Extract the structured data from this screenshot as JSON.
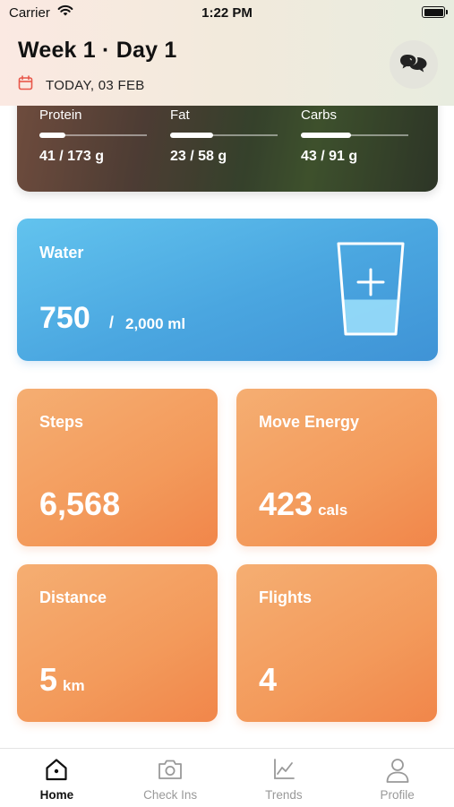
{
  "status_bar": {
    "carrier": "Carrier",
    "time": "1:22 PM"
  },
  "header": {
    "title": "Week 1 · Day 1",
    "date": "TODAY, 03 FEB",
    "accent": "#e8574a"
  },
  "macros": [
    {
      "label": "Protein",
      "value": "41 / 173 g",
      "progress": 0.24
    },
    {
      "label": "Fat",
      "value": "23 / 58 g",
      "progress": 0.4
    },
    {
      "label": "Carbs",
      "value": "43 / 91 g",
      "progress": 0.47
    }
  ],
  "water": {
    "title": "Water",
    "amount": "750",
    "separator": "/",
    "goal": "2,000 ml",
    "fill_fraction": 0.375,
    "icon": "glass-plus-icon"
  },
  "stats": [
    {
      "title": "Steps",
      "value": "6,568",
      "unit": ""
    },
    {
      "title": "Move Energy",
      "value": "423",
      "unit": "cals"
    },
    {
      "title": "Distance",
      "value": "5",
      "unit": "km"
    },
    {
      "title": "Flights",
      "value": "4",
      "unit": ""
    }
  ],
  "tabs": [
    {
      "label": "Home",
      "icon": "home-icon",
      "active": true
    },
    {
      "label": "Check Ins",
      "icon": "camera-icon",
      "active": false
    },
    {
      "label": "Trends",
      "icon": "trends-icon",
      "active": false
    },
    {
      "label": "Profile",
      "icon": "profile-icon",
      "active": false
    }
  ],
  "colors": {
    "water_card": "#4aa6e0",
    "stat_card": "#f39a5b",
    "tab_active": "#111111",
    "tab_inactive": "#999999"
  }
}
